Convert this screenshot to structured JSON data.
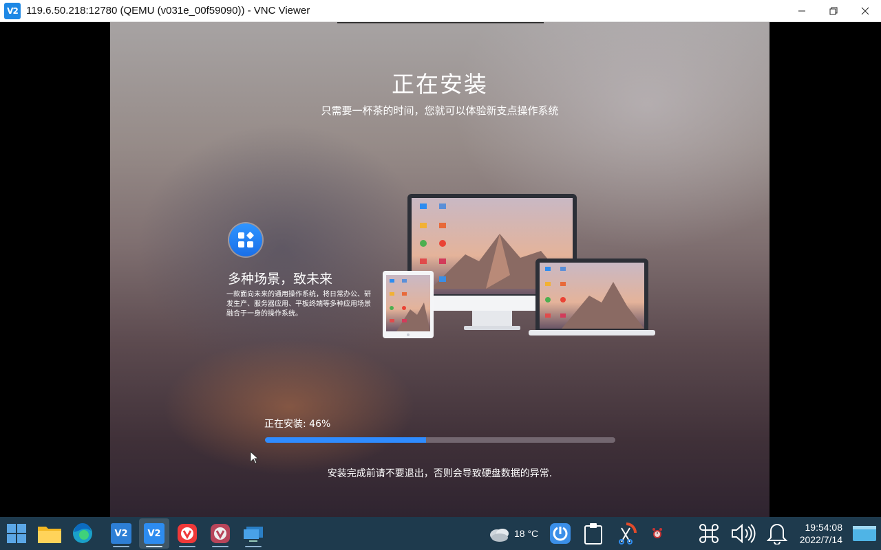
{
  "window": {
    "title": "119.6.50.218:12780 (QEMU (v031e_00f59090)) - VNC Viewer",
    "app_icon_text": "V2",
    "minimize_icon": "minimize-icon",
    "restore_icon": "restore-icon",
    "close_icon": "close-icon"
  },
  "installer": {
    "title": "正在安装",
    "subtitle": "只需要一杯茶的时间，您就可以体验新支点操作系统",
    "feature_title": "多种场景，致未来",
    "feature_desc": "一款面向未来的通用操作系统，将日常办公、研发生产、服务器应用、平板终端等多种应用场景融合于一身的操作系统。",
    "progress_label": "正在安装: 46%",
    "progress_value": 0.46,
    "warning": "安装完成前请不要退出，否则会导致硬盘数据的异常.",
    "accent_color": "#2f8cff"
  },
  "taskbar": {
    "start_icon": "windows-start-icon",
    "pinned": [
      {
        "name": "file-explorer-icon"
      },
      {
        "name": "edge-browser-icon"
      },
      {
        "name": "vnc-viewer-icon"
      },
      {
        "name": "vnc-viewer-active-icon"
      },
      {
        "name": "vivaldi-icon"
      },
      {
        "name": "vivaldi-alt-icon"
      },
      {
        "name": "remote-desktop-icon"
      }
    ],
    "weather": {
      "icon": "cloudy-icon",
      "temp": "18 °C"
    },
    "tray_icons": [
      "app-tray-icon",
      "clipboard-icon",
      "snipping-tool-icon",
      "alarm-icon",
      "command-icon",
      "volume-icon",
      "notification-bell-icon",
      "show-desktop-icon"
    ],
    "time": "19:54:08",
    "date": "2022/7/14"
  }
}
